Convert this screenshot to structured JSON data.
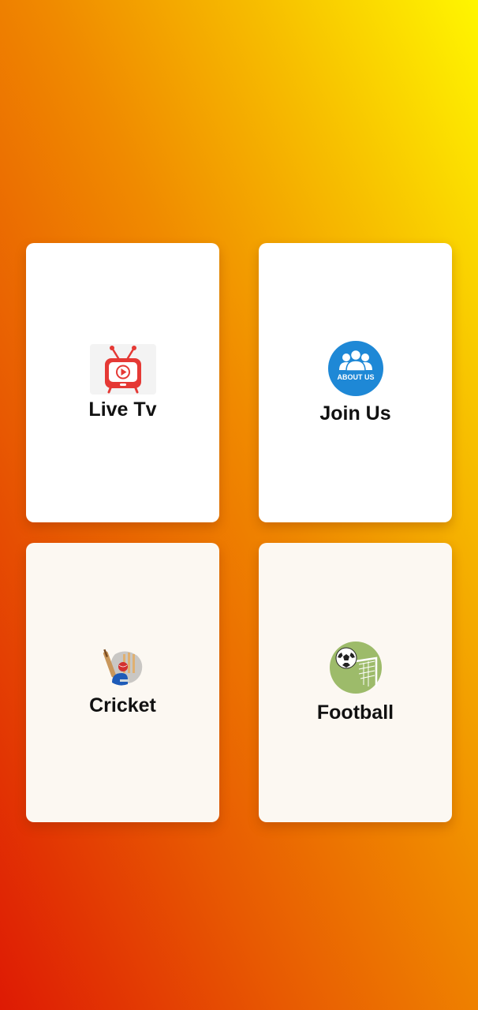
{
  "menu": {
    "cards": [
      {
        "label": "Live Tv",
        "icon": "tv-play-icon"
      },
      {
        "label": "Join Us",
        "icon": "about-us-icon",
        "icon_text": "ABOUT US"
      },
      {
        "label": "Cricket",
        "icon": "cricket-icon"
      },
      {
        "label": "Football",
        "icon": "football-icon"
      }
    ]
  },
  "colors": {
    "gradient_bottom_left": "#de1a04",
    "gradient_top_right": "#fff600",
    "card_white": "#ffffff",
    "card_cream": "#fcf8f2",
    "tv_red": "#e53935",
    "about_blue": "#1e88d6",
    "football_green": "#9dbb6a",
    "label_text": "#111111"
  }
}
